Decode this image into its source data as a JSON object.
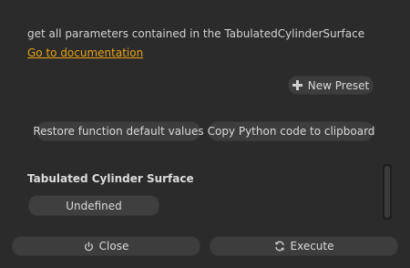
{
  "description": {
    "text": "get all parameters contained in the TabulatedCylinderSurface"
  },
  "documentation_link": {
    "label": "Go to documentation"
  },
  "preset": {
    "new_preset_label": "New Preset",
    "icon": "plus-icon"
  },
  "actions": {
    "restore_label": "Restore function default values",
    "copy_label": "Copy Python code to clipboard"
  },
  "parameter": {
    "title": "Tabulated Cylinder Surface",
    "value": "Undefined"
  },
  "footer": {
    "close_label": "Close",
    "close_icon": "power-icon",
    "execute_label": "Execute",
    "execute_icon": "refresh-icon"
  }
}
